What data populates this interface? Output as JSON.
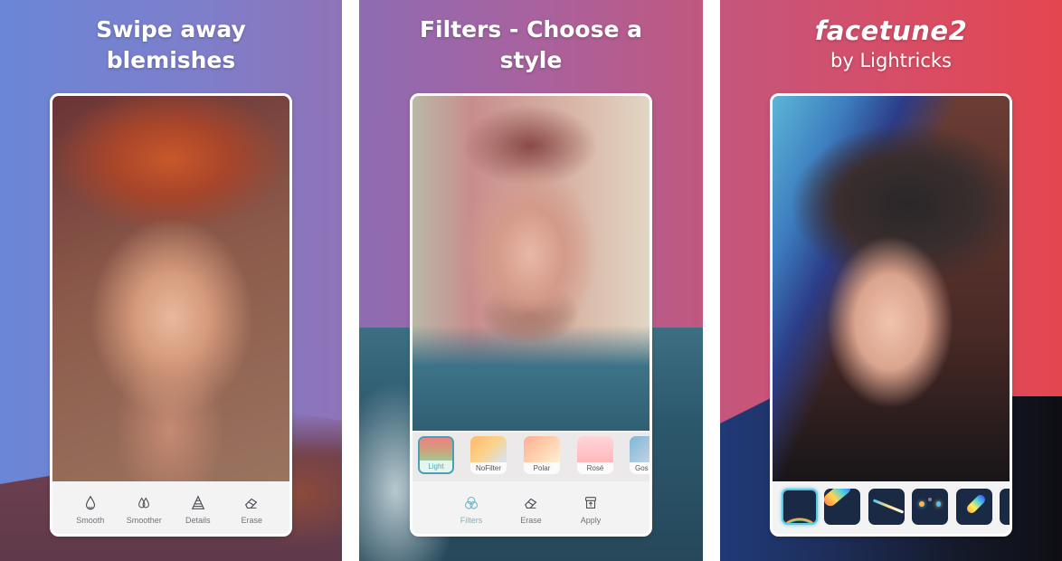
{
  "panels": [
    {
      "headline": [
        "Swipe away",
        "blemishes"
      ],
      "background": [
        "#6a86d6",
        "#8f73b8"
      ],
      "tools": [
        {
          "label": "Smooth",
          "icon": "drop-icon"
        },
        {
          "label": "Smoother",
          "icon": "double-drop-icon"
        },
        {
          "label": "Details",
          "icon": "pyramid-icon"
        },
        {
          "label": "Erase",
          "icon": "eraser-icon"
        }
      ]
    },
    {
      "headline": [
        "Filters - Choose a",
        "style"
      ],
      "background": [
        "#8e6cb3",
        "#c0587f"
      ],
      "filters": [
        {
          "label": "Light",
          "selected": true
        },
        {
          "label": "NoFilter",
          "selected": false
        },
        {
          "label": "Polar",
          "selected": false
        },
        {
          "label": "Rosé",
          "selected": false
        },
        {
          "label": "Gos",
          "selected": false
        }
      ],
      "tools": [
        {
          "label": "Filters",
          "icon": "filters-icon",
          "active": true
        },
        {
          "label": "Erase",
          "icon": "eraser-icon",
          "active": false
        },
        {
          "label": "Apply",
          "icon": "apply-icon",
          "active": false
        }
      ],
      "accent": "#6fb6cc"
    },
    {
      "brand": {
        "logo": "facetune2",
        "sub": "by Lightricks"
      },
      "background": [
        "#c4567d",
        "#e4464f"
      ],
      "effects": [
        {
          "name": "rainbow-arc",
          "selected": true
        },
        {
          "name": "light-leak-blob",
          "selected": false
        },
        {
          "name": "light-streak",
          "selected": false
        },
        {
          "name": "bokeh-dots",
          "selected": false
        },
        {
          "name": "prism-flare",
          "selected": false
        },
        {
          "name": "more",
          "selected": false
        }
      ]
    }
  ]
}
